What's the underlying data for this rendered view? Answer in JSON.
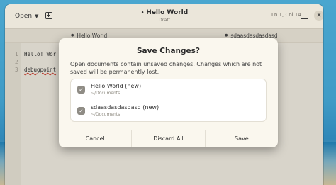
{
  "header": {
    "open_label": "Open",
    "title": "Hello World",
    "title_modified_marker": "•",
    "subtitle": "Draft",
    "cursor_position": "Ln 1, Col 14"
  },
  "tabs": [
    {
      "label": "Hello World",
      "marker": "●"
    },
    {
      "label": "sdaasdasdasdasd",
      "marker": "●"
    }
  ],
  "editor": {
    "line_numbers": [
      "1",
      "2",
      "3"
    ],
    "lines": [
      "Hello! Wor",
      "",
      "debugpoint"
    ]
  },
  "dialog": {
    "title": "Save Changes?",
    "message": "Open documents contain unsaved changes. Changes which are not saved will be permanently lost.",
    "documents": [
      {
        "name": "Hello World (new)",
        "path": "~/Documents",
        "checked": true
      },
      {
        "name": "sdaasdasdasdasd (new)",
        "path": "~/Documents",
        "checked": true
      }
    ],
    "buttons": {
      "cancel": "Cancel",
      "discard": "Discard All",
      "save": "Save"
    }
  },
  "colors": {
    "window_bg": "#e7e2d6",
    "dialog_bg": "#faf7ee",
    "checkbox": "#8f8c85"
  }
}
